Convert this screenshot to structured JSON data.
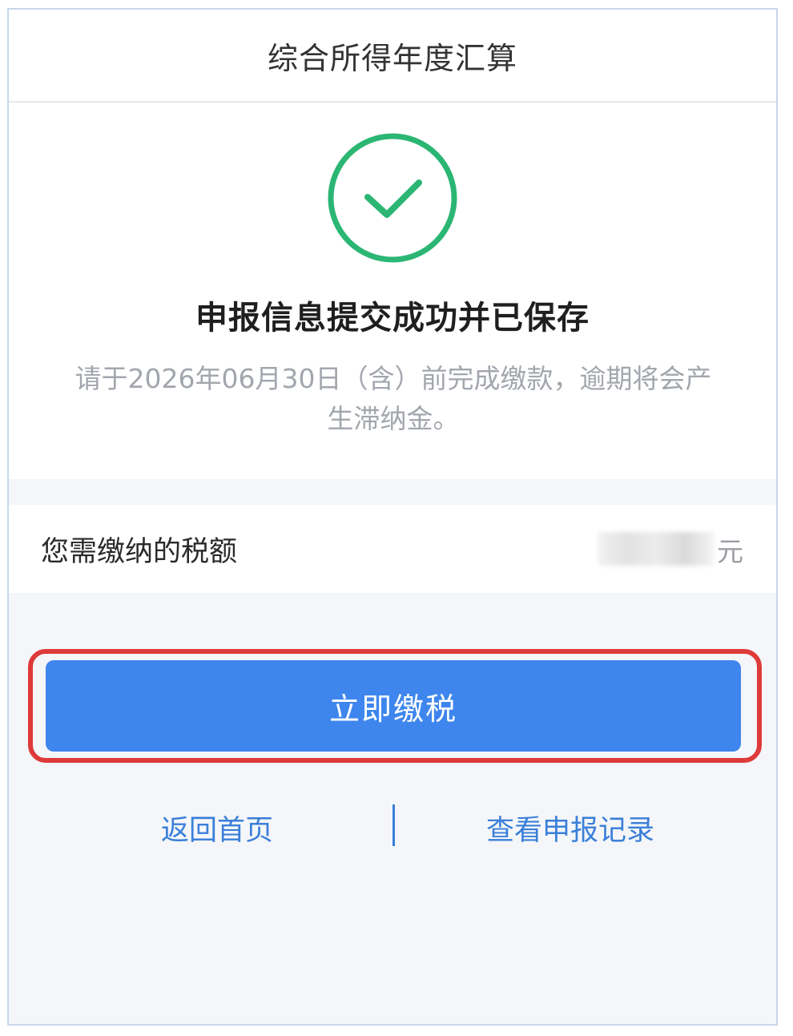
{
  "header": {
    "title": "综合所得年度汇算"
  },
  "result": {
    "icon": "check-circle-icon",
    "title": "申报信息提交成功并已保存",
    "description": "请于2026年06月30日（含）前完成缴款，逾期将会产生滞纳金。"
  },
  "tax": {
    "label": "您需缴纳的税额",
    "amount": "",
    "unit": "元"
  },
  "actions": {
    "pay_label": "立即缴税",
    "home_label": "返回首页",
    "records_label": "查看申报记录"
  },
  "colors": {
    "accent": "#3e86ee",
    "success": "#2bb673",
    "highlight": "#de3a3a",
    "link": "#3a7fd9"
  }
}
